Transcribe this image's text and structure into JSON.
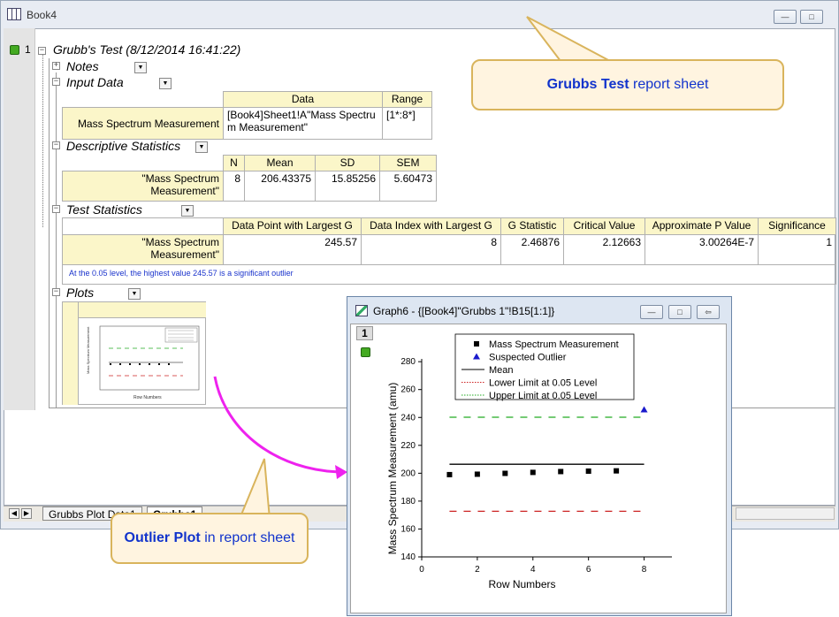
{
  "book_window": {
    "title": "Book4",
    "row_number": "1",
    "report_title": "Grubb's Test (8/12/2014 16:41:22)"
  },
  "sections": {
    "notes": "Notes",
    "input_data": "Input Data",
    "descriptive_statistics": "Descriptive Statistics",
    "test_statistics": "Test Statistics",
    "plots": "Plots"
  },
  "input_table": {
    "headers": [
      "Data",
      "Range"
    ],
    "row_label": "Mass Spectrum Measurement",
    "data_line1": "[Book4]Sheet1!A\"Mass Spectru",
    "data_line2": "m Measurement\"",
    "range": "[1*:8*]"
  },
  "descriptive_table": {
    "headers": [
      "N",
      "Mean",
      "SD",
      "SEM"
    ],
    "row_label_line1": "\"Mass Spectrum",
    "row_label_line2": "Measurement\"",
    "values": [
      "8",
      "206.43375",
      "15.85256",
      "5.60473"
    ]
  },
  "test_table": {
    "headers": [
      "Data Point with Largest G",
      "Data Index with Largest G",
      "G Statistic",
      "Critical Value",
      "Approximate P Value",
      "Significance"
    ],
    "row_label_line1": "\"Mass Spectrum",
    "row_label_line2": "Measurement\"",
    "values": [
      "245.57",
      "8",
      "2.46876",
      "2.12663",
      "3.00264E-7",
      "1"
    ],
    "note": "At the 0.05 level, the highest value 245.57 is a significant outlier"
  },
  "sheet_tabs": [
    "Grubbs Plot Data1",
    "Grubbs1"
  ],
  "callouts": {
    "report_bold": "Grubbs Test",
    "report_rest": " report sheet",
    "plot_bold": "Outlier Plot",
    "plot_rest": " in report sheet"
  },
  "graph_window": {
    "title": "Graph6 - {[Book4]\"Grubbs 1\"!B15[1:1]}",
    "layer_number": "1"
  },
  "chart_data": {
    "type": "scatter",
    "xlabel": "Row Numbers",
    "ylabel": "Mass Spectrum Measurement (amu)",
    "xlim": [
      0,
      9
    ],
    "ylim": [
      140,
      282
    ],
    "xticks": [
      0,
      2,
      4,
      6,
      8
    ],
    "yticks": [
      140,
      160,
      180,
      200,
      220,
      240,
      260,
      280
    ],
    "legend_position": "top",
    "series": [
      {
        "name": "Mass Spectrum Measurement",
        "marker": "square",
        "color": "#000000",
        "x": [
          1,
          2,
          3,
          4,
          5,
          6,
          7
        ],
        "y": [
          199.0,
          199.3,
          199.9,
          200.6,
          201.2,
          201.5,
          201.7
        ]
      },
      {
        "name": "Suspected Outlier",
        "marker": "triangle",
        "color": "#1a1acc",
        "x": [
          8
        ],
        "y": [
          245.57
        ]
      }
    ],
    "lines": [
      {
        "name": "Mean",
        "value": 206.43,
        "color": "#000000",
        "style": "solid"
      },
      {
        "name": "Lower Limit at 0.05 Level",
        "value": 172.72,
        "color": "#cc2222",
        "style": "dashed"
      },
      {
        "name": "Upper Limit at 0.05 Level",
        "value": 240.14,
        "color": "#22aa22",
        "style": "dashed"
      }
    ]
  },
  "thumbnail_axis_label": "Row Numbers"
}
